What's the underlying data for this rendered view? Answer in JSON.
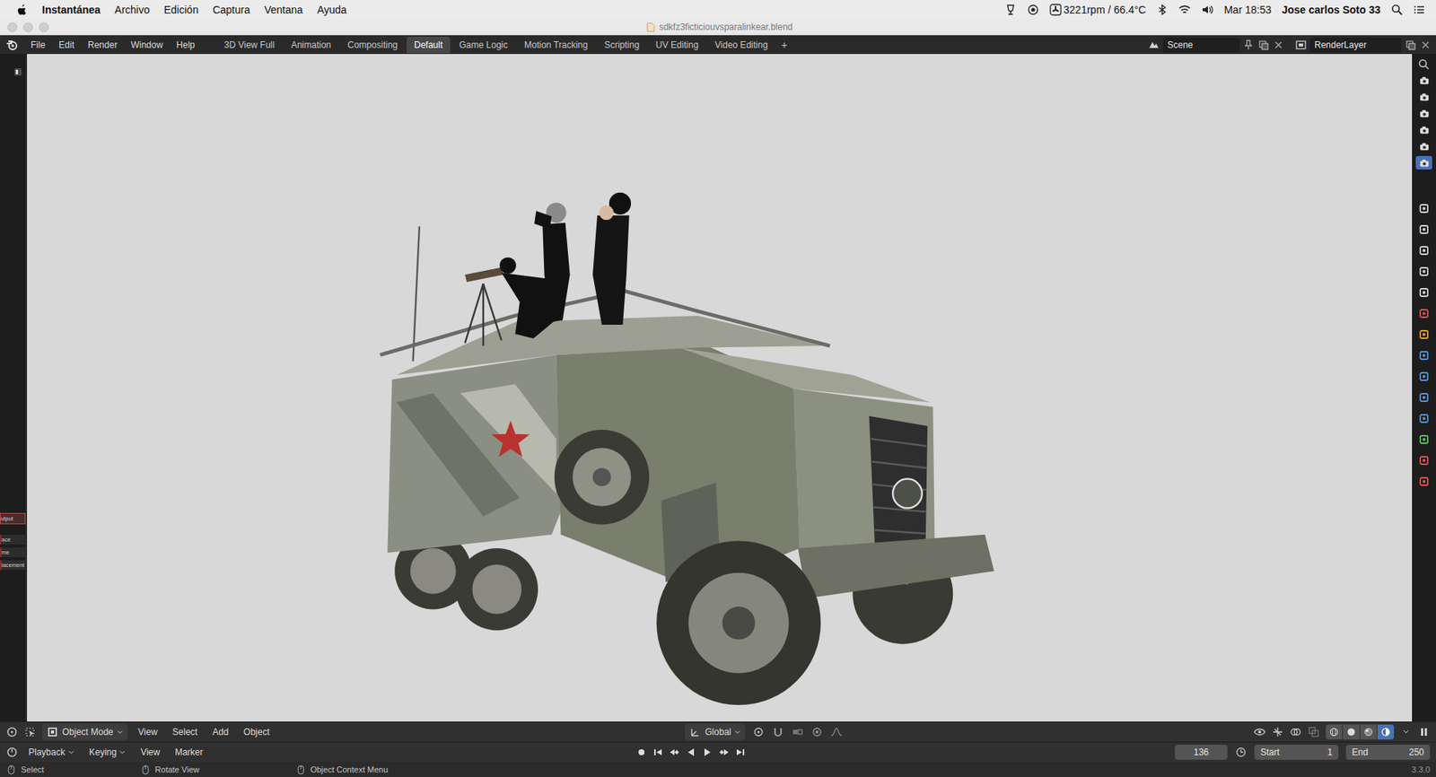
{
  "menubar": {
    "app": "Instantánea",
    "menus": [
      "Archivo",
      "Edición",
      "Captura",
      "Ventana",
      "Ayuda"
    ],
    "sensors": "3221rpm / 66.4°C",
    "clock": "Mar 18:53",
    "user": "Jose carlos Soto 33"
  },
  "window": {
    "title": "sdkfz3ficticiouvsparalinkear.blend"
  },
  "topbar": {
    "menus": [
      "File",
      "Edit",
      "Render",
      "Window",
      "Help"
    ],
    "workspaces": [
      {
        "label": "3D View Full",
        "selected": false
      },
      {
        "label": "Animation",
        "selected": false
      },
      {
        "label": "Compositing",
        "selected": false
      },
      {
        "label": "Default",
        "selected": true
      },
      {
        "label": "Game Logic",
        "selected": false
      },
      {
        "label": "Motion Tracking",
        "selected": false
      },
      {
        "label": "Scripting",
        "selected": false
      },
      {
        "label": "UV Editing",
        "selected": false
      },
      {
        "label": "Video Editing",
        "selected": false
      }
    ],
    "add_workspace": "+",
    "scene": "Scene",
    "view_layer": "RenderLayer"
  },
  "side_panel": {
    "tabs": [
      {
        "label": "utput",
        "selected": true
      },
      {
        "label": "ace",
        "selected": false
      },
      {
        "label": "me",
        "selected": false
      },
      {
        "label": "lacement",
        "selected": false
      }
    ]
  },
  "render_slots": [
    {
      "selected": false
    },
    {
      "selected": false
    },
    {
      "selected": false
    },
    {
      "selected": false
    },
    {
      "selected": false
    },
    {
      "selected": true
    }
  ],
  "viewport_header": {
    "mode": "Object Mode",
    "menus": [
      "View",
      "Select",
      "Add",
      "Object"
    ],
    "orientation": "Global",
    "shading": [
      {
        "kind": "wireframe",
        "selected": false
      },
      {
        "kind": "solid",
        "selected": false
      },
      {
        "kind": "material",
        "selected": false
      },
      {
        "kind": "rendered",
        "selected": true
      }
    ]
  },
  "timeline": {
    "menus": [
      {
        "label": "Playback",
        "dropdown": true
      },
      {
        "label": "Keying",
        "dropdown": true
      },
      {
        "label": "View",
        "dropdown": false
      },
      {
        "label": "Marker",
        "dropdown": false
      }
    ],
    "current_frame": "136",
    "start_label": "Start",
    "start": "1",
    "end_label": "End",
    "end": "250"
  },
  "status_bar": {
    "hints": [
      "Select",
      "Rotate View",
      "Object Context Menu"
    ],
    "version": "3.3.0"
  }
}
